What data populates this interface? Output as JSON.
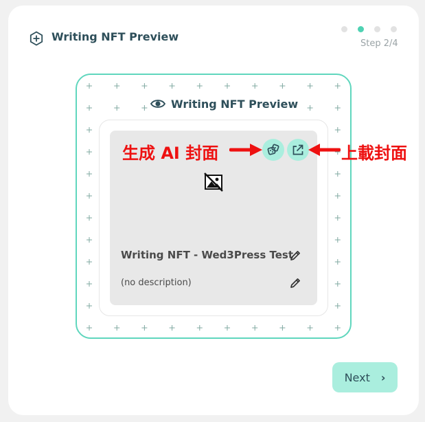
{
  "header": {
    "title": "Writing NFT Preview",
    "step": "Step 2/4",
    "icon": "plus-circle-icon"
  },
  "stepper": {
    "total": 4,
    "current": 2
  },
  "preview": {
    "title": "Writing NFT Preview",
    "title_icon": "eye-icon",
    "nft_name": "Writing NFT - Wed3Press Test",
    "nft_description": "(no description)",
    "image_icon": "broken-image-icon"
  },
  "annotations": {
    "left": "生成 AI 封面",
    "right": "上載封面"
  },
  "footer": {
    "next_label": "Next"
  },
  "colors": {
    "accent": "#4fd2b3",
    "button_bg": "#aaeede",
    "frame_border": "#5fd6bd",
    "annotation": "#ee1111",
    "text_dark": "#2e4f5a"
  }
}
